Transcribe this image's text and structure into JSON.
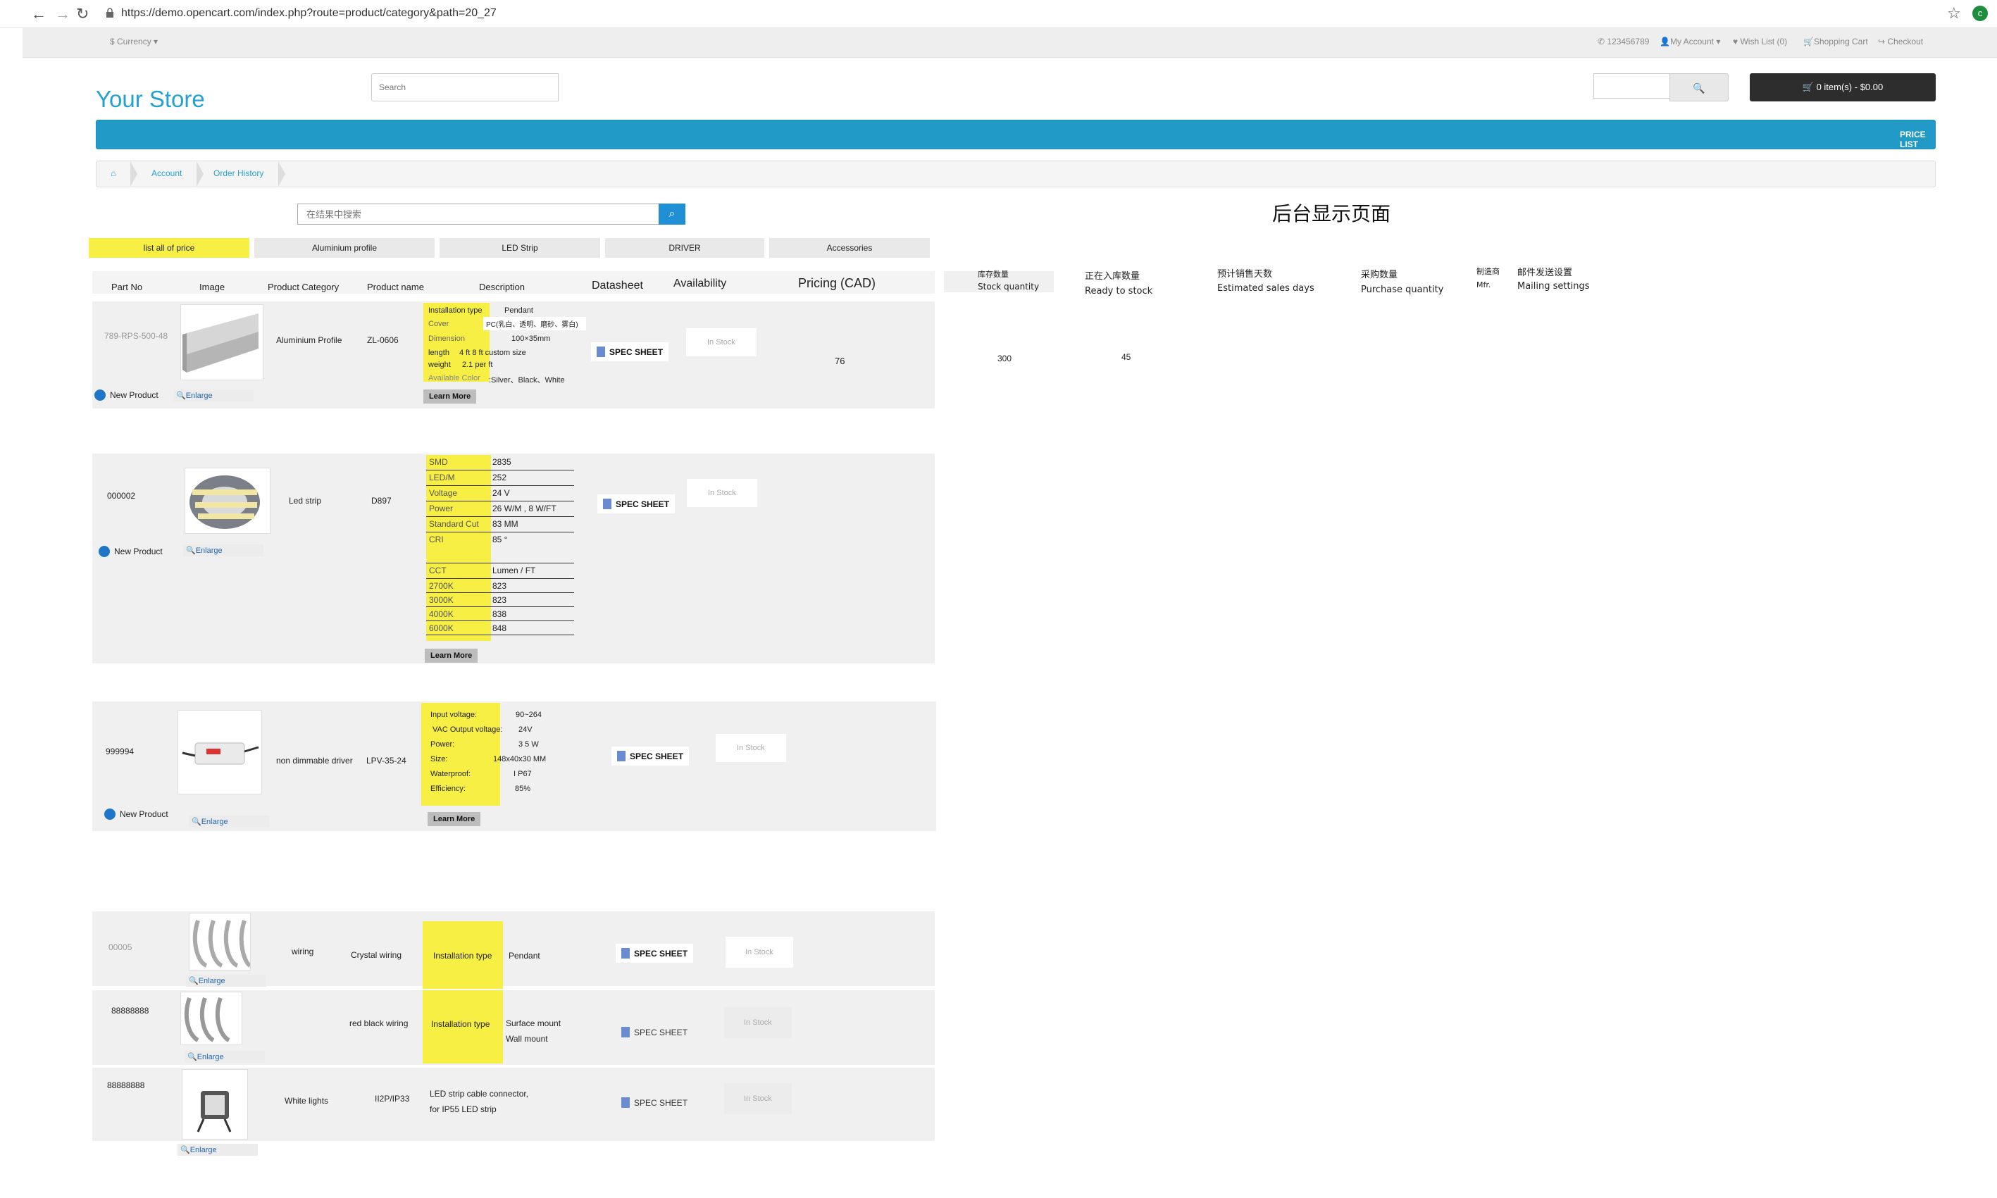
{
  "browser": {
    "url": "https://demo.opencart.com/index.php?route=product/category&path=20_27",
    "avatar_letter": "c"
  },
  "topbar": {
    "currency": "$ Currency ▾",
    "phone": "123456789",
    "my_account": "My Account ▾",
    "wishlist": "Wish List (0)",
    "cart": "Shopping Cart",
    "checkout": "Checkout"
  },
  "header": {
    "store_name": "Your Store",
    "search_placeholder": "Search",
    "cart_button": "0 item(s) - $0.00"
  },
  "menu": {
    "price_list": "PRICE LIST"
  },
  "breadcrumb": {
    "items": [
      "Account",
      "Order History"
    ]
  },
  "search_within": {
    "placeholder": "在结果中搜索"
  },
  "backend_title": "后台显示页面",
  "tabs": [
    "list  all of price",
    "Aluminium profile",
    "LED Strip",
    "DRIVER",
    "Accessories"
  ],
  "columns": {
    "part_no": "Part No",
    "image": "Image",
    "category": "Product Category",
    "name": "Product name",
    "description": "Description",
    "datasheet": "Datasheet",
    "availability": "Availability",
    "pricing": "Pricing (CAD)"
  },
  "backend_columns": {
    "stock_zh": "库存数量",
    "stock_en": "Stock quantity",
    "ready_zh": "正在入库数量",
    "ready_en": "Ready to stock",
    "est_zh": "预计销售天数",
    "est_en": "Estimated sales days",
    "purchase_zh": "采购数量",
    "purchase_en": "Purchase quantity",
    "mfr_zh": "制造商",
    "mfr_en": "Mfr.",
    "mail_zh": "邮件发送设置",
    "mail_en": "Mailing settings"
  },
  "common": {
    "new_product": "New Product",
    "enlarge": "Enlarge",
    "learn_more": "Learn More",
    "spec_sheet": "SPEC SHEET",
    "in_stock": "In Stock"
  },
  "products": [
    {
      "part_no": "789-RPS-500-48",
      "category": "Aluminium Profile",
      "name": "ZL-0606",
      "desc": [
        {
          "k": "Installation type",
          "v": "Pendant"
        },
        {
          "k": "Cover",
          "v": "PC(乳白、透明、磨砂、雾白)"
        },
        {
          "k": "Dimension",
          "v": "100×35mm"
        },
        {
          "k": "length",
          "v": "4 ft    8 ft     custom size"
        },
        {
          "k": "weight",
          "v": "2.1 per ft"
        },
        {
          "k": "Available Color",
          "v": ":Silver、Black、White"
        }
      ],
      "price": "76",
      "stock_qty": "300",
      "ready_qty": "45"
    },
    {
      "part_no": "000002",
      "category": "Led strip",
      "name": "D897",
      "specs": [
        {
          "k": "SMD",
          "v": "2835"
        },
        {
          "k": "LED/M",
          "v": "252"
        },
        {
          "k": "Voltage",
          "v": "24 V"
        },
        {
          "k": "Power",
          "v": "26 W/M , 8 W/FT"
        },
        {
          "k": "Standard Cut",
          "v": "83 MM"
        },
        {
          "k": "CRI",
          "v": "85 °"
        },
        {
          "k": "",
          "v": ""
        },
        {
          "k": "CCT",
          "v": "Lumen / FT"
        },
        {
          "k": "2700K",
          "v": "823"
        },
        {
          "k": "3000K",
          "v": "823"
        },
        {
          "k": "4000K",
          "v": "838"
        },
        {
          "k": "6000K",
          "v": "848"
        }
      ]
    },
    {
      "part_no": "999994",
      "category": "non dimmable driver",
      "name": "LPV-35-24",
      "desc": [
        {
          "k": "Input voltage:",
          "v": "90~264"
        },
        {
          "k": "VAC Output voltage:",
          "v": "24V"
        },
        {
          "k": "Power:",
          "v": "3 5 W"
        },
        {
          "k": "Size:",
          "v": "148x40x30 MM"
        },
        {
          "k": "Waterproof:",
          "v": "I P67"
        },
        {
          "k": "Efficiency:",
          "v": "85%"
        }
      ]
    },
    {
      "part_no": "00005",
      "category": "wiring",
      "name": "Crystal wiring",
      "install_label": "Installation type",
      "install_value": "Pendant"
    },
    {
      "part_no": "88888888",
      "category": "",
      "name": "red black wiring",
      "install_label": "Installation type",
      "install_value": "Surface mount",
      "install_value2": "Wall mount"
    },
    {
      "part_no": "88888888",
      "category": "White lights",
      "name": "II2P/IP33",
      "desc_line1": "LED strip cable connector,",
      "desc_line2": "for IP55 LED strip"
    }
  ],
  "colors": {
    "accent": "#229ac8",
    "highlight": "#f7ef44",
    "link": "#2367b1"
  }
}
